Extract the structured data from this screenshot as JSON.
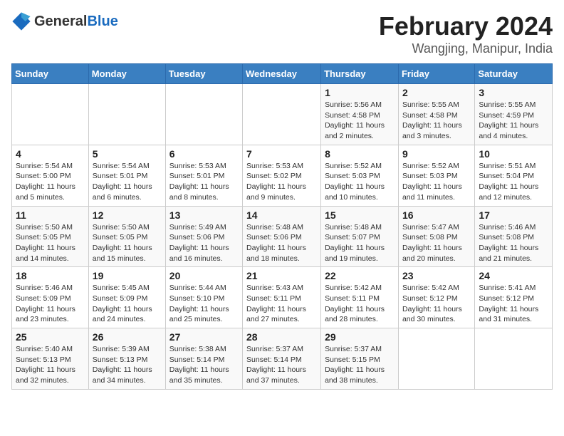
{
  "header": {
    "logo_general": "General",
    "logo_blue": "Blue",
    "main_title": "February 2024",
    "subtitle": "Wangjing, Manipur, India"
  },
  "weekdays": [
    "Sunday",
    "Monday",
    "Tuesday",
    "Wednesday",
    "Thursday",
    "Friday",
    "Saturday"
  ],
  "weeks": [
    [
      {
        "day": "",
        "info": ""
      },
      {
        "day": "",
        "info": ""
      },
      {
        "day": "",
        "info": ""
      },
      {
        "day": "",
        "info": ""
      },
      {
        "day": "1",
        "info": "Sunrise: 5:56 AM\nSunset: 4:58 PM\nDaylight: 11 hours and 2 minutes."
      },
      {
        "day": "2",
        "info": "Sunrise: 5:55 AM\nSunset: 4:58 PM\nDaylight: 11 hours and 3 minutes."
      },
      {
        "day": "3",
        "info": "Sunrise: 5:55 AM\nSunset: 4:59 PM\nDaylight: 11 hours and 4 minutes."
      }
    ],
    [
      {
        "day": "4",
        "info": "Sunrise: 5:54 AM\nSunset: 5:00 PM\nDaylight: 11 hours and 5 minutes."
      },
      {
        "day": "5",
        "info": "Sunrise: 5:54 AM\nSunset: 5:01 PM\nDaylight: 11 hours and 6 minutes."
      },
      {
        "day": "6",
        "info": "Sunrise: 5:53 AM\nSunset: 5:01 PM\nDaylight: 11 hours and 8 minutes."
      },
      {
        "day": "7",
        "info": "Sunrise: 5:53 AM\nSunset: 5:02 PM\nDaylight: 11 hours and 9 minutes."
      },
      {
        "day": "8",
        "info": "Sunrise: 5:52 AM\nSunset: 5:03 PM\nDaylight: 11 hours and 10 minutes."
      },
      {
        "day": "9",
        "info": "Sunrise: 5:52 AM\nSunset: 5:03 PM\nDaylight: 11 hours and 11 minutes."
      },
      {
        "day": "10",
        "info": "Sunrise: 5:51 AM\nSunset: 5:04 PM\nDaylight: 11 hours and 12 minutes."
      }
    ],
    [
      {
        "day": "11",
        "info": "Sunrise: 5:50 AM\nSunset: 5:05 PM\nDaylight: 11 hours and 14 minutes."
      },
      {
        "day": "12",
        "info": "Sunrise: 5:50 AM\nSunset: 5:05 PM\nDaylight: 11 hours and 15 minutes."
      },
      {
        "day": "13",
        "info": "Sunrise: 5:49 AM\nSunset: 5:06 PM\nDaylight: 11 hours and 16 minutes."
      },
      {
        "day": "14",
        "info": "Sunrise: 5:48 AM\nSunset: 5:06 PM\nDaylight: 11 hours and 18 minutes."
      },
      {
        "day": "15",
        "info": "Sunrise: 5:48 AM\nSunset: 5:07 PM\nDaylight: 11 hours and 19 minutes."
      },
      {
        "day": "16",
        "info": "Sunrise: 5:47 AM\nSunset: 5:08 PM\nDaylight: 11 hours and 20 minutes."
      },
      {
        "day": "17",
        "info": "Sunrise: 5:46 AM\nSunset: 5:08 PM\nDaylight: 11 hours and 21 minutes."
      }
    ],
    [
      {
        "day": "18",
        "info": "Sunrise: 5:46 AM\nSunset: 5:09 PM\nDaylight: 11 hours and 23 minutes."
      },
      {
        "day": "19",
        "info": "Sunrise: 5:45 AM\nSunset: 5:09 PM\nDaylight: 11 hours and 24 minutes."
      },
      {
        "day": "20",
        "info": "Sunrise: 5:44 AM\nSunset: 5:10 PM\nDaylight: 11 hours and 25 minutes."
      },
      {
        "day": "21",
        "info": "Sunrise: 5:43 AM\nSunset: 5:11 PM\nDaylight: 11 hours and 27 minutes."
      },
      {
        "day": "22",
        "info": "Sunrise: 5:42 AM\nSunset: 5:11 PM\nDaylight: 11 hours and 28 minutes."
      },
      {
        "day": "23",
        "info": "Sunrise: 5:42 AM\nSunset: 5:12 PM\nDaylight: 11 hours and 30 minutes."
      },
      {
        "day": "24",
        "info": "Sunrise: 5:41 AM\nSunset: 5:12 PM\nDaylight: 11 hours and 31 minutes."
      }
    ],
    [
      {
        "day": "25",
        "info": "Sunrise: 5:40 AM\nSunset: 5:13 PM\nDaylight: 11 hours and 32 minutes."
      },
      {
        "day": "26",
        "info": "Sunrise: 5:39 AM\nSunset: 5:13 PM\nDaylight: 11 hours and 34 minutes."
      },
      {
        "day": "27",
        "info": "Sunrise: 5:38 AM\nSunset: 5:14 PM\nDaylight: 11 hours and 35 minutes."
      },
      {
        "day": "28",
        "info": "Sunrise: 5:37 AM\nSunset: 5:14 PM\nDaylight: 11 hours and 37 minutes."
      },
      {
        "day": "29",
        "info": "Sunrise: 5:37 AM\nSunset: 5:15 PM\nDaylight: 11 hours and 38 minutes."
      },
      {
        "day": "",
        "info": ""
      },
      {
        "day": "",
        "info": ""
      }
    ]
  ]
}
